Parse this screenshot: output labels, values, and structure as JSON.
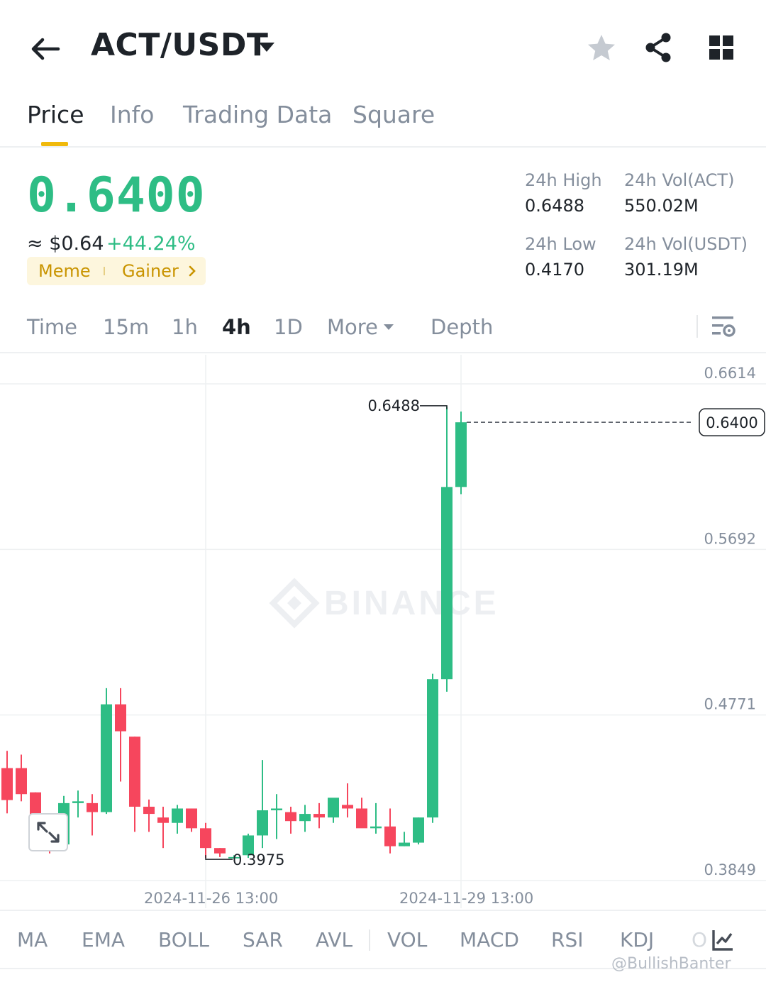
{
  "header": {
    "pair": "ACT/USDT",
    "icons": [
      "back-arrow-icon",
      "caret-down-icon",
      "star-icon",
      "share-icon",
      "grid-icon"
    ]
  },
  "tabs": [
    {
      "label": "Price",
      "active": true
    },
    {
      "label": "Info",
      "active": false
    },
    {
      "label": "Trading Data",
      "active": false
    },
    {
      "label": "Square",
      "active": false
    }
  ],
  "price": {
    "last": "0.6400",
    "approx": "≈ $0.64",
    "change": "+44.24%",
    "tags": [
      "Meme",
      "Gainer"
    ],
    "colors": {
      "up": "#2ebd85",
      "down": "#f6465d",
      "accent": "#f0b90b"
    }
  },
  "stats": {
    "high_label": "24h High",
    "high_value": "0.6488",
    "low_label": "24h Low",
    "low_value": "0.4170",
    "vol_act_label": "24h Vol(ACT)",
    "vol_act_value": "550.02M",
    "vol_usdt_label": "24h Vol(USDT)",
    "vol_usdt_value": "301.19M"
  },
  "intervals": [
    {
      "label": "Time",
      "active": false
    },
    {
      "label": "15m",
      "active": false
    },
    {
      "label": "1h",
      "active": false
    },
    {
      "label": "4h",
      "active": true
    },
    {
      "label": "1D",
      "active": false
    },
    {
      "label": "More",
      "active": false
    },
    {
      "label": "Depth",
      "active": false
    }
  ],
  "chart_data": {
    "type": "candlestick",
    "interval": "4h",
    "y_ticks": [
      "0.6614",
      "0.5692",
      "0.4771",
      "0.3849"
    ],
    "ylim": [
      0.3849,
      0.6614
    ],
    "x_ticks": [
      "2024-11-26 13:00",
      "2024-11-29 13:00"
    ],
    "current_price": "0.6400",
    "high_marker": "0.6488",
    "low_marker": "0.3975",
    "watermark": "BINANCE",
    "candles": [
      {
        "o": 0.4475,
        "h": 0.4571,
        "l": 0.4223,
        "c": 0.4297
      },
      {
        "o": 0.4475,
        "h": 0.455,
        "l": 0.429,
        "c": 0.433
      },
      {
        "o": 0.434,
        "h": 0.434,
        "l": 0.408,
        "c": 0.41
      },
      {
        "o": 0.41,
        "h": 0.41,
        "l": 0.4,
        "c": 0.405
      },
      {
        "o": 0.405,
        "h": 0.432,
        "l": 0.402,
        "c": 0.428
      },
      {
        "o": 0.428,
        "h": 0.435,
        "l": 0.42,
        "c": 0.429
      },
      {
        "o": 0.428,
        "h": 0.433,
        "l": 0.41,
        "c": 0.423
      },
      {
        "o": 0.423,
        "h": 0.492,
        "l": 0.422,
        "c": 0.483
      },
      {
        "o": 0.483,
        "h": 0.492,
        "l": 0.44,
        "c": 0.468
      },
      {
        "o": 0.465,
        "h": 0.465,
        "l": 0.412,
        "c": 0.426
      },
      {
        "o": 0.426,
        "h": 0.43,
        "l": 0.412,
        "c": 0.422
      },
      {
        "o": 0.42,
        "h": 0.426,
        "l": 0.403,
        "c": 0.417
      },
      {
        "o": 0.417,
        "h": 0.427,
        "l": 0.411,
        "c": 0.425
      },
      {
        "o": 0.425,
        "h": 0.425,
        "l": 0.412,
        "c": 0.414
      },
      {
        "o": 0.414,
        "h": 0.417,
        "l": 0.3975,
        "c": 0.403
      },
      {
        "o": 0.403,
        "h": 0.403,
        "l": 0.398,
        "c": 0.4
      },
      {
        "o": 0.398,
        "h": 0.399,
        "l": 0.398,
        "c": 0.398
      },
      {
        "o": 0.399,
        "h": 0.411,
        "l": 0.3975,
        "c": 0.41
      },
      {
        "o": 0.41,
        "h": 0.452,
        "l": 0.403,
        "c": 0.424
      },
      {
        "o": 0.424,
        "h": 0.433,
        "l": 0.408,
        "c": 0.425
      },
      {
        "o": 0.423,
        "h": 0.426,
        "l": 0.411,
        "c": 0.418
      },
      {
        "o": 0.418,
        "h": 0.427,
        "l": 0.412,
        "c": 0.422
      },
      {
        "o": 0.422,
        "h": 0.428,
        "l": 0.414,
        "c": 0.42
      },
      {
        "o": 0.42,
        "h": 0.43,
        "l": 0.417,
        "c": 0.431
      },
      {
        "o": 0.427,
        "h": 0.439,
        "l": 0.42,
        "c": 0.425
      },
      {
        "o": 0.425,
        "h": 0.431,
        "l": 0.416,
        "c": 0.414
      },
      {
        "o": 0.414,
        "h": 0.428,
        "l": 0.411,
        "c": 0.415
      },
      {
        "o": 0.415,
        "h": 0.425,
        "l": 0.4,
        "c": 0.404
      },
      {
        "o": 0.404,
        "h": 0.412,
        "l": 0.404,
        "c": 0.406
      },
      {
        "o": 0.406,
        "h": 0.42,
        "l": 0.405,
        "c": 0.42
      },
      {
        "o": 0.42,
        "h": 0.5,
        "l": 0.417,
        "c": 0.497
      },
      {
        "o": 0.497,
        "h": 0.6488,
        "l": 0.49,
        "c": 0.604
      },
      {
        "o": 0.604,
        "h": 0.646,
        "l": 0.6,
        "c": 0.64
      }
    ]
  },
  "indicators": [
    "MA",
    "EMA",
    "BOLL",
    "SAR",
    "AVL",
    "VOL",
    "MACD",
    "RSI",
    "KDJ",
    "O"
  ],
  "watermark": "@BullishBanter"
}
